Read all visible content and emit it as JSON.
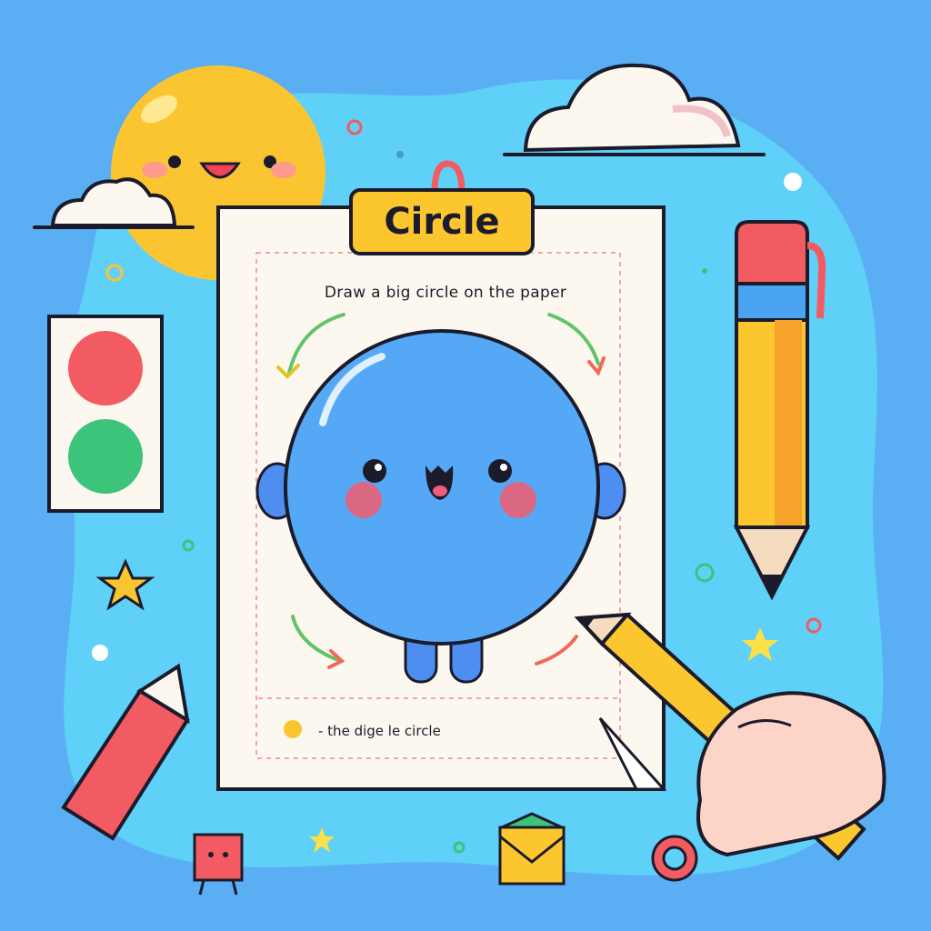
{
  "worksheet": {
    "title": "Circle",
    "instruction": "Draw a big circle on the paper",
    "caption": "- the dige le circle"
  },
  "colors": {
    "background": "#5aaef4",
    "blob": "#5fd0f7",
    "paper": "#fdf8ef",
    "circle_character": "#55a8f5",
    "sun": "#fbc531",
    "title_tag": "#fcc62f",
    "outline": "#1b1b2b",
    "traffic_red": "#f35b62",
    "traffic_green": "#3cc47b"
  },
  "decorations": [
    "sun-face",
    "cloud",
    "traffic-light-card",
    "pencil",
    "crayon",
    "hand-holding-pencil",
    "star",
    "envelope",
    "small-square-character",
    "ring"
  ]
}
